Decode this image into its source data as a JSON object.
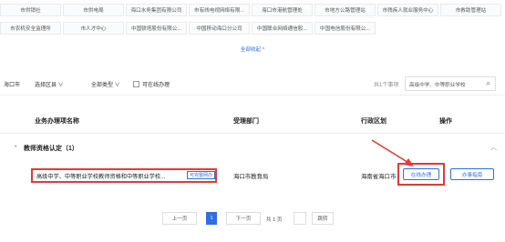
{
  "departments": {
    "row1": [
      "市供销社",
      "市供电局",
      "海口水务集团有限公司",
      "市有线电视网络有限...",
      "海口市港航管理处",
      "市地方公路管理站",
      "市残疾人就业服务中心",
      "市救助管理站"
    ],
    "row2": [
      "市农机安全监理所",
      "市人才中心",
      "中国铁塔股份有限公...",
      "中国移动海口分公司",
      "中国联合网络通信股...",
      "中国电信股份有限公..."
    ]
  },
  "collapse_label": "全部收起 ^",
  "filter": {
    "city": "海口市",
    "district": "选择区县 ∨",
    "type": "全部类型 ∨",
    "online_only": "可在线办理",
    "count": "共1个事项",
    "search_value": "高级中学、中等职业学校"
  },
  "table": {
    "headers": [
      "业务办理项名称",
      "受理部门",
      "行政区划",
      "操作"
    ],
    "group_label": "教师资格认定（1）",
    "rows": [
      {
        "name": "高级中学、中等职业学校教师资格和中等职业学校...",
        "tag": "可完整网办",
        "dept": "海口市教育局",
        "region": "海南省海口市",
        "actions": [
          "在线办理",
          "办事指南"
        ]
      }
    ]
  },
  "pager": {
    "prev": "上一页",
    "current": "1",
    "next": "下一页",
    "total": "共 1 页",
    "goto": "跳转"
  }
}
